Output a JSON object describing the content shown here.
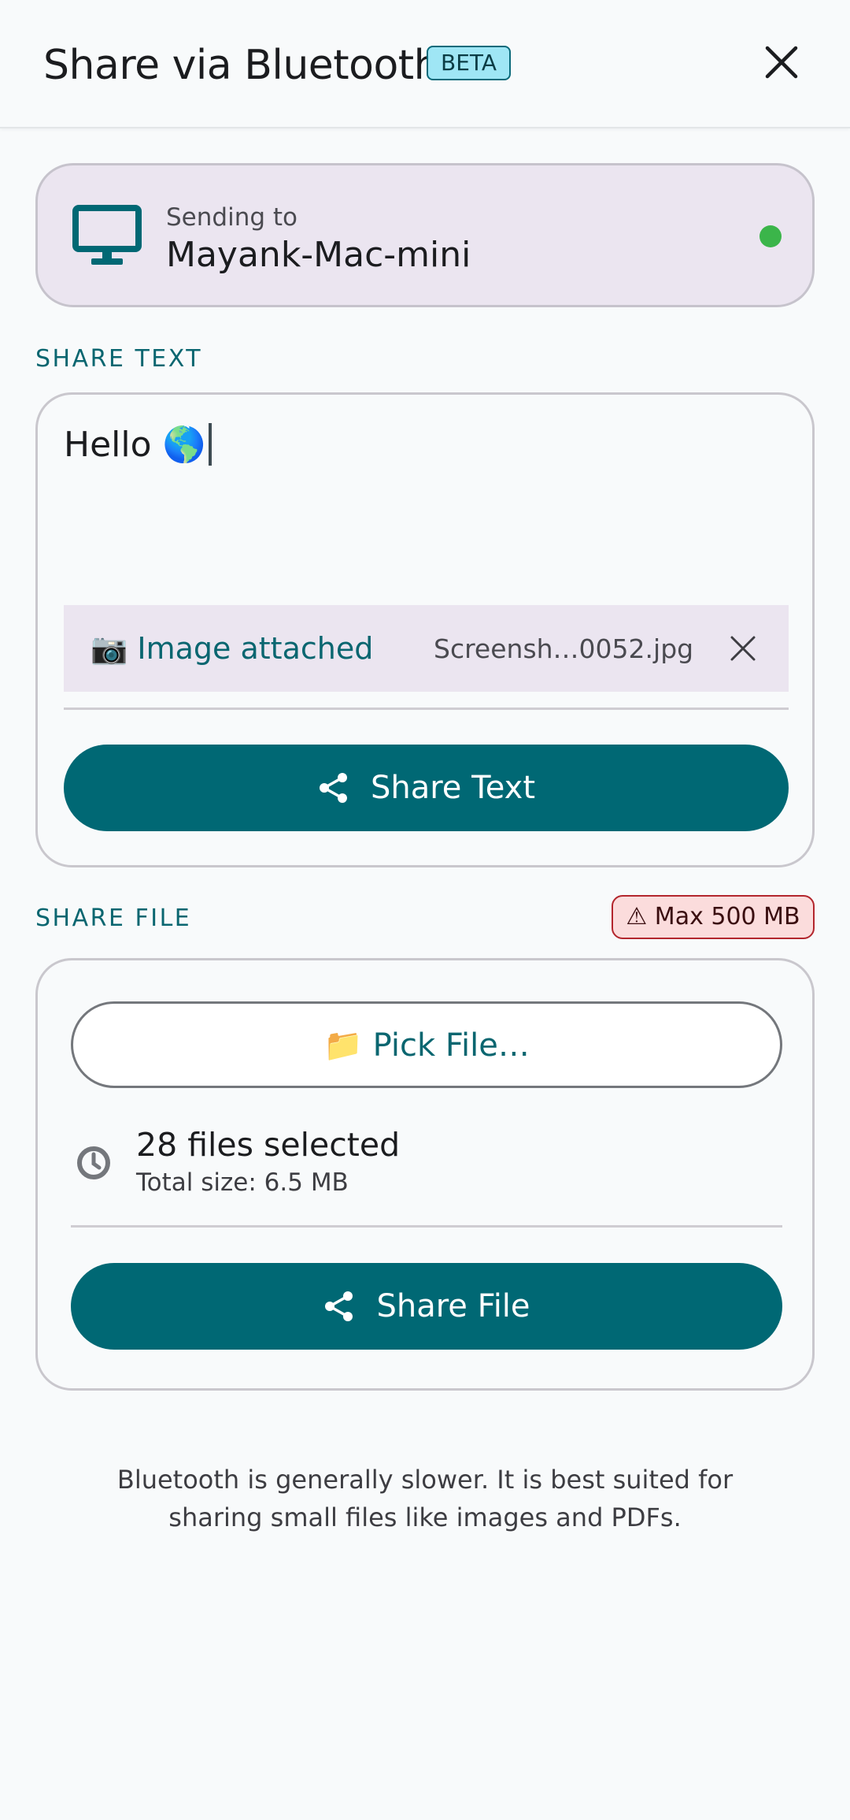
{
  "header": {
    "title": "Share via Bluetooth",
    "badge": "BETA",
    "close_icon": "close-icon"
  },
  "device": {
    "sending_label": "Sending to",
    "name": "Mayank-Mac-mini",
    "icon": "monitor-icon",
    "status_color": "#3bb54a"
  },
  "share_text": {
    "section_label": "SHARE TEXT",
    "text_value": "Hello 🌎",
    "attachment": {
      "label": "📷 Image attached",
      "file_name": "Screensh…0052.jpg",
      "remove_icon": "close-icon"
    },
    "button_label": "Share Text",
    "button_icon": "share-icon"
  },
  "share_file": {
    "section_label": "SHARE FILE",
    "limit_badge": "⚠ Max 500 MB",
    "pick_button_label": "📁 Pick File…",
    "files_count": "28 files selected",
    "total_size": "Total size: 6.5 MB",
    "status_icon": "clock-icon",
    "button_label": "Share File",
    "button_icon": "share-icon"
  },
  "footer": {
    "note": "Bluetooth is generally slower. It is best suited for sharing small files like images and PDFs."
  },
  "colors": {
    "primary": "#006874",
    "surface_variant": "#ebe5f0",
    "error_container": "#fbdcdc",
    "online": "#3bb54a"
  }
}
